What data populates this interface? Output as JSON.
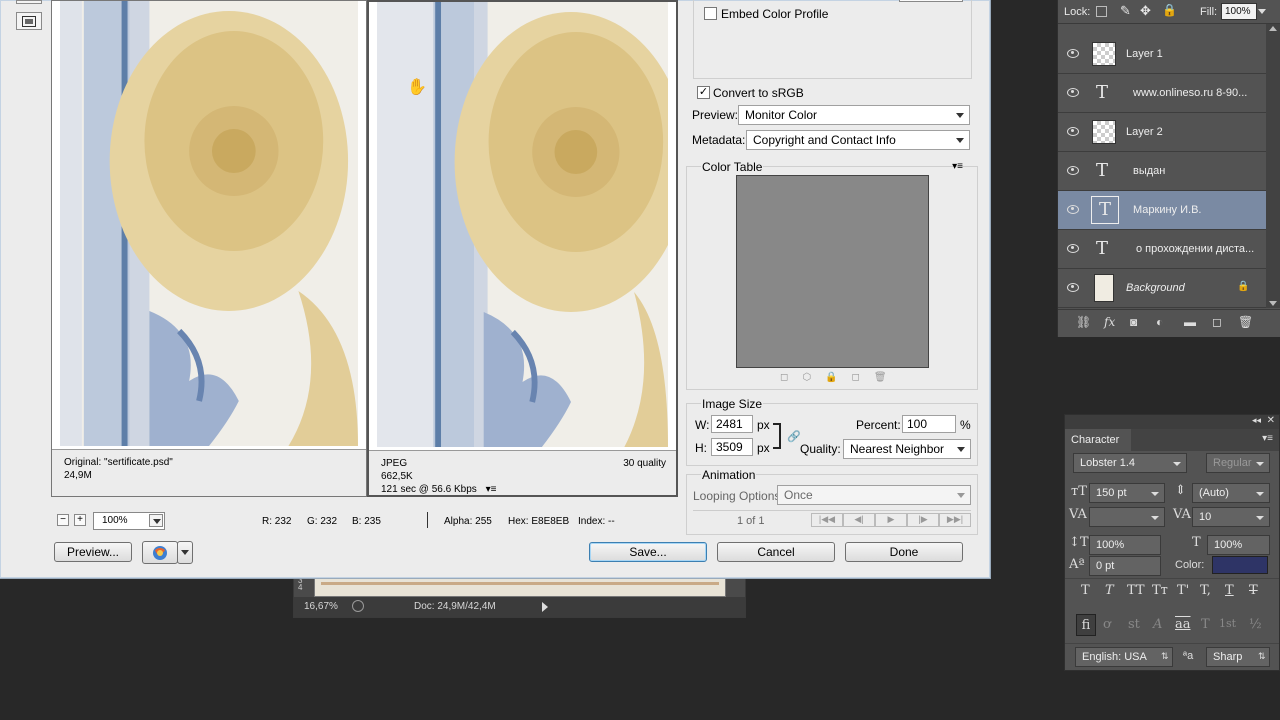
{
  "document_window": {
    "ruler": [
      "3",
      "4"
    ],
    "zoom": "16,67%",
    "doc_info": "Doc: 24,9M/42,4M"
  },
  "dialog": {
    "original_pane": {
      "line1": "Original: \"sertificate.psd\"",
      "line2": "24,9M"
    },
    "optimized_pane": {
      "format": "JPEG",
      "size": "662,5K",
      "speed": "121 sec @ 56.6 Kbps",
      "quality": "30 quality"
    },
    "zoom_level": "100%",
    "color_readout": {
      "r": "R: 232",
      "g": "G: 232",
      "b": "B: 235",
      "alpha": "Alpha: 255",
      "hex": "Hex: E8E8EB",
      "index": "Index: --"
    },
    "buttons": {
      "preview": "Preview...",
      "save": "Save...",
      "cancel": "Cancel",
      "done": "Done"
    },
    "settings": {
      "embed_color_profile": {
        "label": "Embed Color Profile",
        "checked": false
      },
      "convert_srgb": {
        "label": "Convert to sRGB",
        "checked": true
      },
      "preview_label": "Preview:",
      "preview_value": "Monitor Color",
      "metadata_label": "Metadata:",
      "metadata_value": "Copyright and Contact Info",
      "color_table_title": "Color Table",
      "image_size_title": "Image Size",
      "w_label": "W:",
      "w_value": "2481",
      "h_label": "H:",
      "h_value": "3509",
      "px": "px",
      "percent_label": "Percent:",
      "percent_value": "100",
      "percent_unit": "%",
      "quality_label": "Quality:",
      "quality_value": "Nearest Neighbor",
      "animation_title": "Animation",
      "looping_label": "Looping Options:",
      "looping_value": "Once",
      "frame_counter": "1 of 1"
    }
  },
  "layers_panel": {
    "lock_label": "Lock:",
    "fill_label": "Fill:",
    "fill_value": "100%",
    "layers": [
      {
        "name": "Layer 1",
        "type": "raster",
        "selected": false
      },
      {
        "name": "www.onlineso.ru   8-90...",
        "type": "text",
        "selected": false
      },
      {
        "name": "Layer 2",
        "type": "raster",
        "selected": false
      },
      {
        "name": "выдан",
        "type": "text",
        "selected": false
      },
      {
        "name": "Маркину И.В.",
        "type": "text",
        "selected": true
      },
      {
        "name": "о прохождении диста...",
        "type": "text",
        "selected": false
      },
      {
        "name": "Background",
        "type": "background",
        "selected": false
      }
    ]
  },
  "character_panel": {
    "title": "Character",
    "font_family": "Lobster 1.4",
    "font_style": "Regular",
    "font_size": "150 pt",
    "leading": "(Auto)",
    "kerning": "",
    "tracking": "10",
    "vertical_scale": "100%",
    "horizontal_scale": "100%",
    "baseline_shift": "0 pt",
    "color_label": "Color:",
    "color_value": "#2e3466",
    "language": "English: USA",
    "aa_label": "ªa",
    "antialias": "Sharp",
    "type_buttons": [
      "T",
      "T",
      "TT",
      "Tт",
      "T'",
      "T,",
      "T",
      "T"
    ],
    "opentype_buttons": [
      "fi",
      "ơ",
      "st",
      "A",
      "aa",
      "T",
      "1st",
      "½"
    ]
  }
}
